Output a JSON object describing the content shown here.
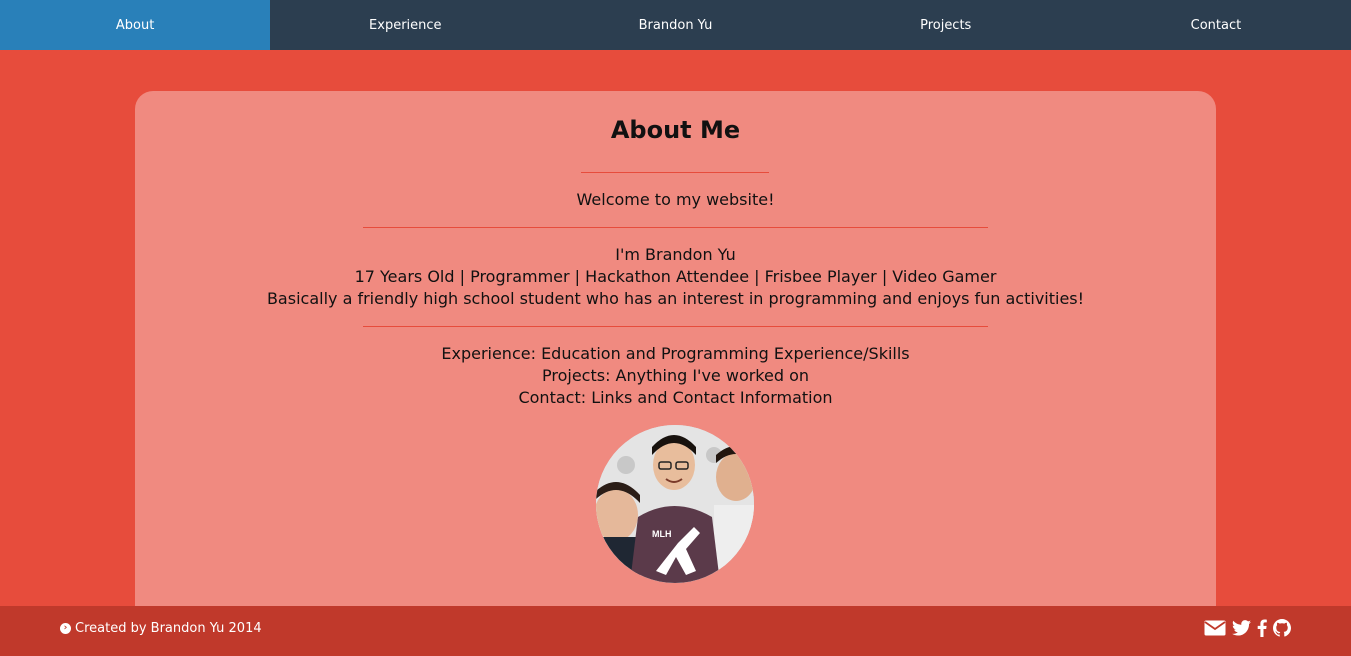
{
  "nav": {
    "items": [
      {
        "label": "About"
      },
      {
        "label": "Experience"
      },
      {
        "label": "Brandon Yu"
      },
      {
        "label": "Projects"
      },
      {
        "label": "Contact"
      }
    ]
  },
  "about": {
    "title": "About Me",
    "welcome": "Welcome to my website!",
    "intro": [
      "I'm Brandon Yu",
      "17 Years Old | Programmer | Hackathon Attendee | Frisbee Player | Video Gamer",
      "Basically a friendly high school student who has an interest in programming and enjoys fun activities!"
    ],
    "sections": [
      "Experience: Education and Programming Experience/Skills",
      "Projects: Anything I've worked on",
      "Contact: Links and Contact Information"
    ]
  },
  "footer": {
    "credit": "Created by Brandon Yu 2014",
    "social_icons": [
      "envelope-icon",
      "twitter-icon",
      "facebook-icon",
      "github-icon"
    ]
  },
  "colors": {
    "nav_bg": "#2c3e50",
    "nav_active": "#2980b9",
    "page_bg": "#e74c3c",
    "card_bg": "#f08a80",
    "footer_bg": "#c0392b"
  }
}
